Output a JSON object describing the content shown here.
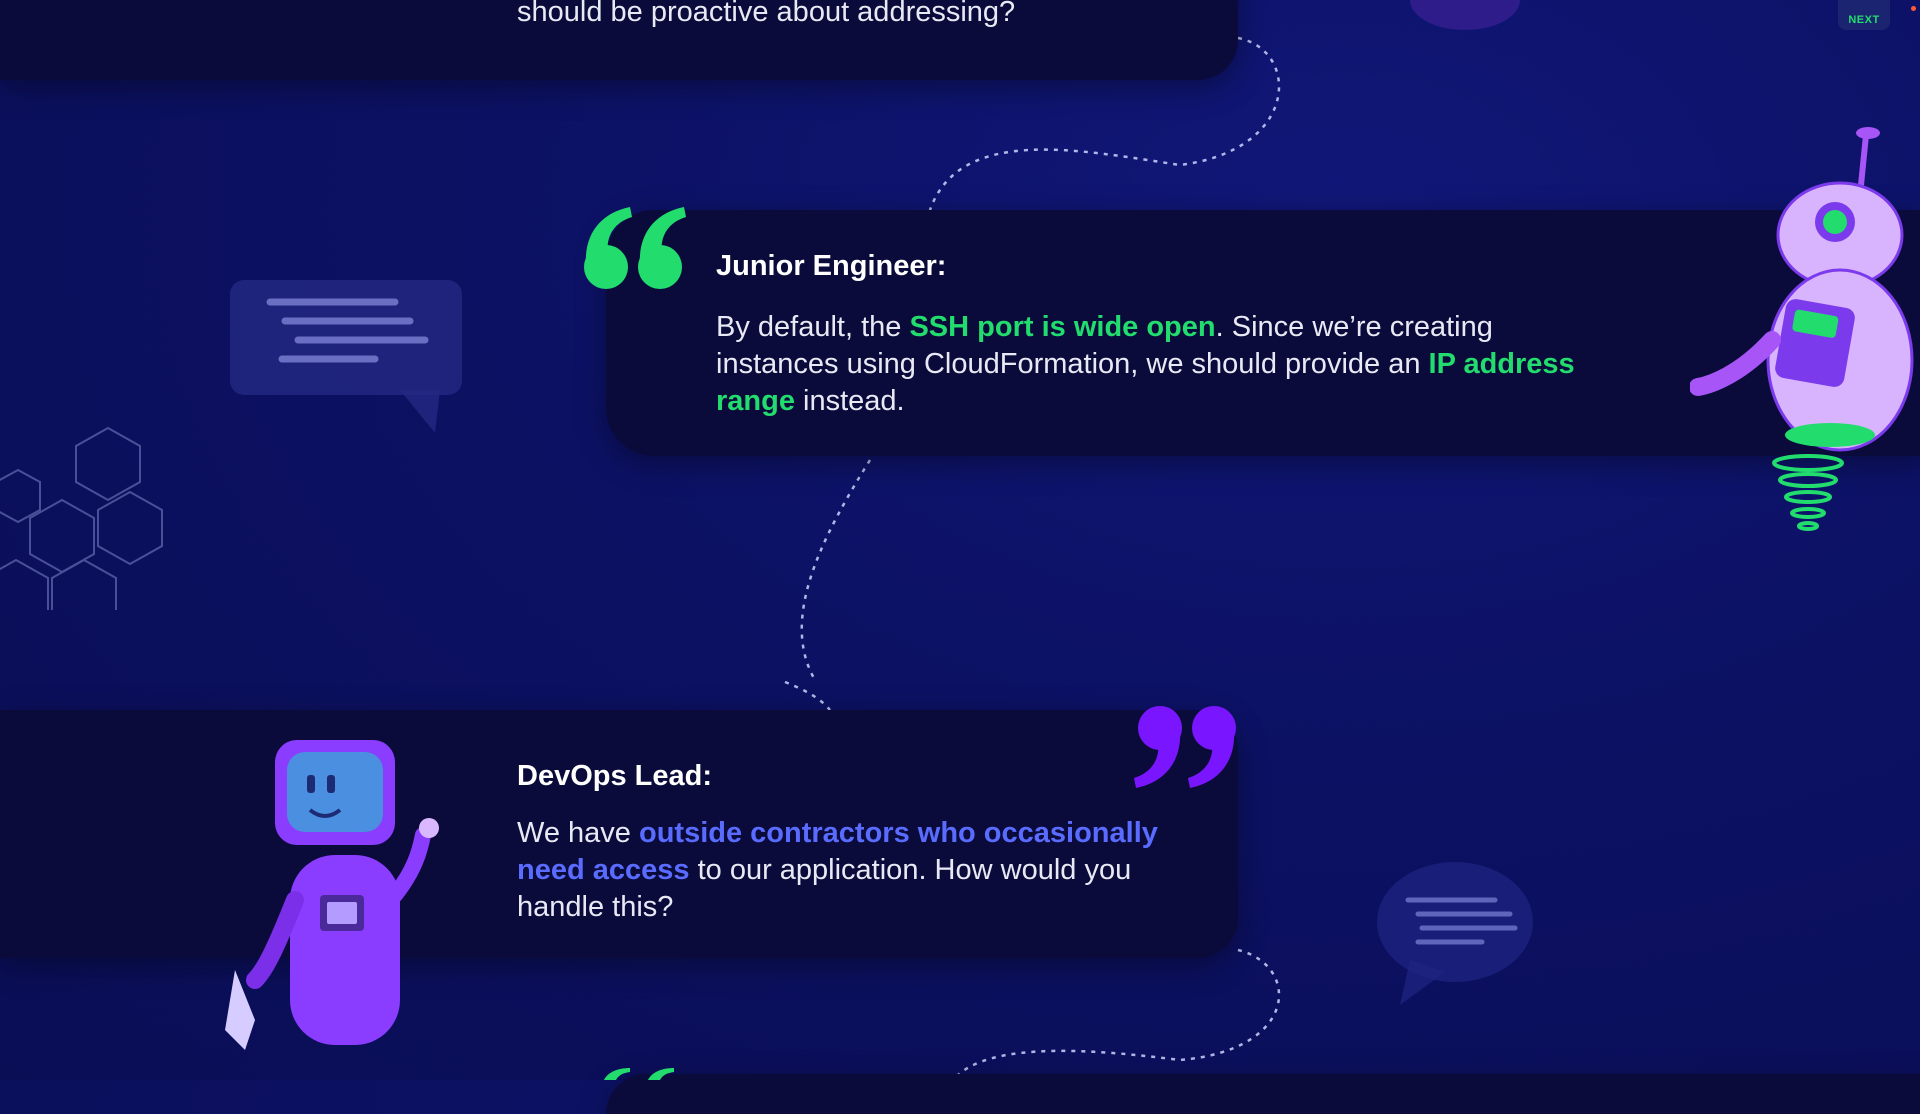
{
  "navigation": {
    "next_label": "NEXT"
  },
  "dialogue": {
    "previous": {
      "text_end": "should be proactive about addressing?"
    },
    "junior": {
      "speaker": "Junior Engineer:",
      "t1": "By default, the ",
      "h1": "SSH port is wide open",
      "t2": ". Since we’re creating instances using CloudFormation, we should provide an ",
      "h2": "IP address range",
      "t3": " instead."
    },
    "devops": {
      "speaker": "DevOps Lead:",
      "t1": "We have ",
      "h1": "outside contractors who occasionally need access",
      "t2": " to our application. How would you handle this?"
    }
  },
  "colors": {
    "background": "#0c1163",
    "card": "#0a0b3a",
    "highlight_green": "#22dd6e",
    "highlight_blue": "#5a6cff",
    "quote_purple": "#7a16ff"
  },
  "icons": [
    "open-quote-icon",
    "close-quote-icon",
    "speech-bubble-icon",
    "hexagon-pattern",
    "robot-illustration",
    "next-button"
  ]
}
